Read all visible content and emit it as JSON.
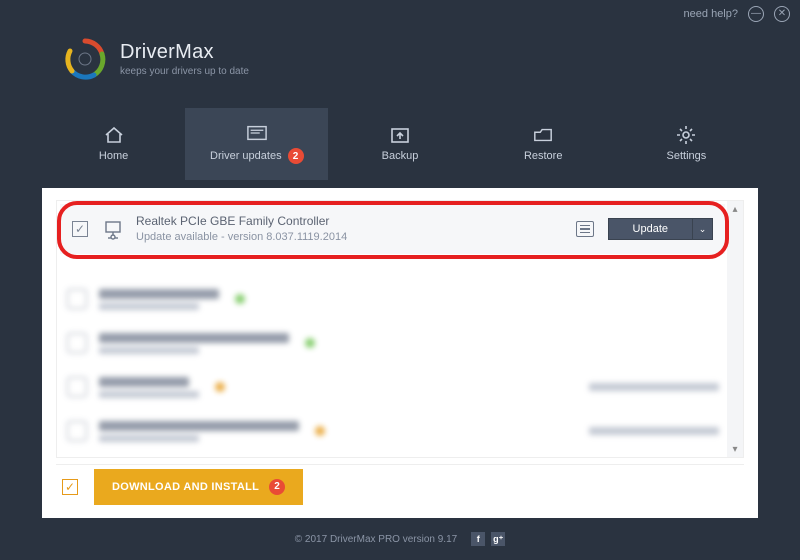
{
  "topbar": {
    "help": "need help?"
  },
  "brand": {
    "title": "DriverMax",
    "subtitle": "keeps your drivers up to date"
  },
  "nav": {
    "home": "Home",
    "updates": "Driver updates",
    "updates_badge": "2",
    "backup": "Backup",
    "restore": "Restore",
    "settings": "Settings"
  },
  "driver": {
    "name": "Realtek PCIe GBE Family Controller",
    "status": "Update available - version 8.037.1119.2014",
    "button": "Update"
  },
  "blur_rows": [
    {
      "title_w": 120,
      "dot": "green"
    },
    {
      "title_w": 190,
      "dot": "green"
    },
    {
      "title_w": 90,
      "dot": "orange",
      "right": true
    },
    {
      "title_w": 200,
      "dot": "orange",
      "right": true
    }
  ],
  "action": {
    "download": "DOWNLOAD AND INSTALL",
    "badge": "2"
  },
  "footer": {
    "copyright": "© 2017 DriverMax PRO version 9.17"
  }
}
